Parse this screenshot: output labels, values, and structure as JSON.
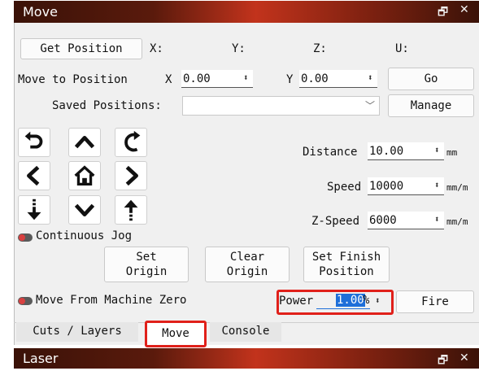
{
  "move_window": {
    "title": "Move",
    "get_position_label": "Get Position",
    "axis_labels": {
      "x": "X:",
      "y": "Y:",
      "z": "Z:",
      "u": "U:"
    },
    "move_to_position": {
      "label": "Move to Position",
      "x_label": "X",
      "x_value": "0.00",
      "y_label": "Y",
      "y_value": "0.00",
      "go_label": "Go"
    },
    "saved_positions": {
      "label": "Saved Positions:",
      "value": "",
      "manage_label": "Manage"
    },
    "jog_buttons": [
      "rotate-ccw-icon",
      "arrow-up-icon",
      "rotate-cw-icon",
      "arrow-left-icon",
      "home-icon",
      "arrow-right-icon",
      "z-down-icon",
      "arrow-down-icon",
      "z-up-icon"
    ],
    "distance": {
      "label": "Distance",
      "value": "10.00",
      "unit": "mm"
    },
    "speed": {
      "label": "Speed",
      "value": "10000",
      "unit": "mm/m"
    },
    "z_speed": {
      "label": "Z-Speed",
      "value": "6000",
      "unit": "mm/m"
    },
    "continuous_jog_label": "Continuous Jog",
    "set_origin": {
      "line1": "Set",
      "line2": "Origin"
    },
    "clear_origin": {
      "line1": "Clear",
      "line2": "Origin"
    },
    "set_finish": {
      "line1": "Set Finish",
      "line2": "Position"
    },
    "move_from_zero_label": "Move From Machine Zero",
    "power": {
      "label": "Power",
      "value": "1.00",
      "unit": "%"
    },
    "fire_label": "Fire"
  },
  "tabs": [
    {
      "label": "Cuts / Layers",
      "active": false
    },
    {
      "label": "Move",
      "active": true
    },
    {
      "label": "Console",
      "active": false
    }
  ],
  "laser_window": {
    "title": "Laser"
  },
  "title_controls": {
    "float": "🗗",
    "close": "✕"
  },
  "colors": {
    "highlight_box": "#e0201a",
    "title_accent": "#c2331c",
    "power_selection": "#1e6fd9"
  }
}
